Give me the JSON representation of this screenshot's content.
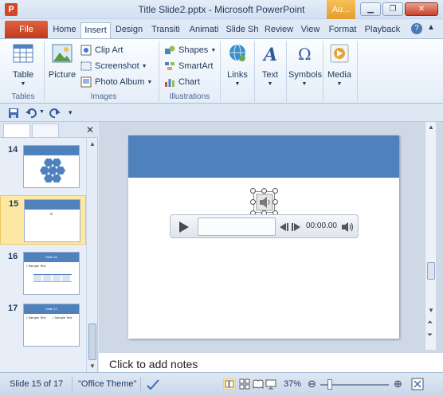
{
  "window": {
    "app_icon_letter": "P",
    "title": "Title Slide2.pptx - Microsoft PowerPoint",
    "context_tab_label": "Au...",
    "minimize_glyph": "▁",
    "maximize_glyph": "❐",
    "close_glyph": "✕"
  },
  "ribbon_tabs": {
    "file": "File",
    "tabs": [
      "Home",
      "Insert",
      "Design",
      "Transiti",
      "Animati",
      "Slide Sh",
      "Review",
      "View",
      "Format",
      "Playback"
    ],
    "active": "Insert"
  },
  "ribbon": {
    "tables": {
      "table_label": "Table",
      "group_label": "Tables"
    },
    "images": {
      "picture_label": "Picture",
      "clip_art_label": "Clip Art",
      "screenshot_label": "Screenshot",
      "photo_album_label": "Photo Album",
      "group_label": "Images"
    },
    "illustrations": {
      "shapes_label": "Shapes",
      "smartart_label": "SmartArt",
      "chart_label": "Chart",
      "group_label": "Illustrations"
    },
    "links_label": "Links",
    "text_label": "Text",
    "symbols_label": "Symbols",
    "media_label": "Media"
  },
  "slides_pane": {
    "thumbnails": [
      {
        "number": "14"
      },
      {
        "number": "15",
        "selected": true
      },
      {
        "number": "16",
        "title": "Slide 16",
        "bullet": "• Sample Text"
      },
      {
        "number": "17",
        "title": "Slide 17",
        "bullet_left": "• Sample Text",
        "bullet_right": "• Sample Text"
      }
    ]
  },
  "player": {
    "time": "00:00.00"
  },
  "notes_placeholder": "Click to add notes",
  "statusbar": {
    "slide_indicator": "Slide 15 of 17",
    "theme": "\"Office Theme\"",
    "zoom": "37%"
  },
  "colors": {
    "slide_header": "#4f81bd",
    "file_tab": "#c03a1b",
    "selected_thumbnail": "#fde9a4",
    "context_tab": "#e39b2d"
  }
}
